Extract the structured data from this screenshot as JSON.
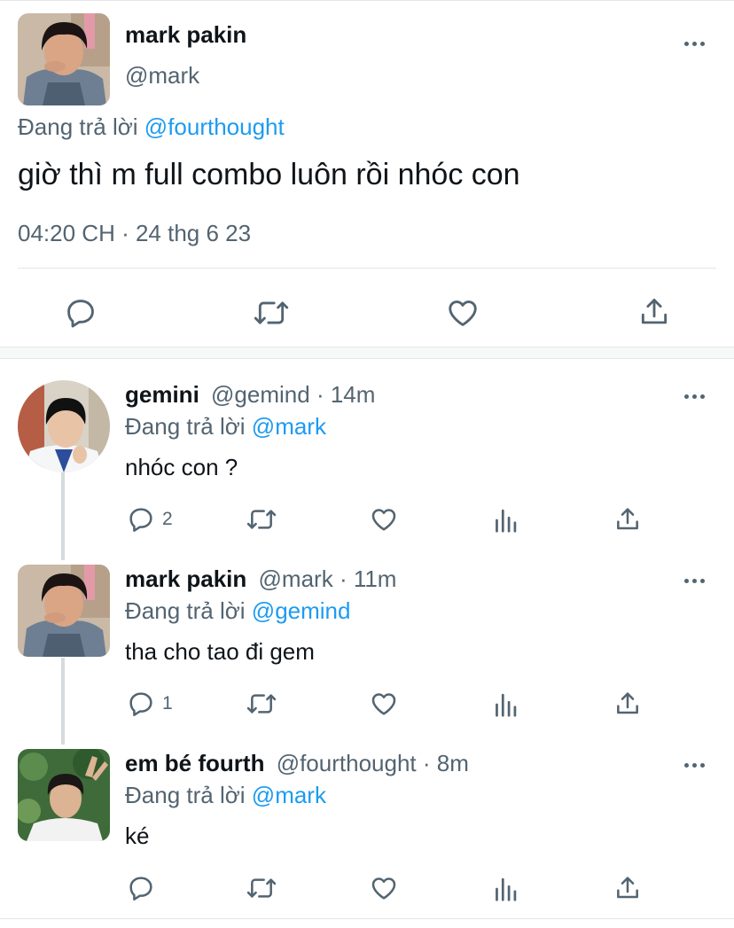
{
  "main_tweet": {
    "name": "mark pakin",
    "handle": "@mark",
    "replying_prefix": "Đang trả lời",
    "replying_to": "@fourthought",
    "text": "giờ thì m full combo luôn rồi nhóc con",
    "timestamp": "04:20 CH · 24 thg 6 23"
  },
  "replies": [
    {
      "name": "gemini",
      "handle": "@gemind",
      "time": "· 14m",
      "replying_prefix": "Đang trả lời",
      "replying_to": "@mark",
      "text": "nhóc con ?",
      "reply_count": "2"
    },
    {
      "name": "mark pakin",
      "handle": "@mark",
      "time": "· 11m",
      "replying_prefix": "Đang trả lời",
      "replying_to": "@gemind",
      "text": "tha cho tao đi gem",
      "reply_count": "1"
    },
    {
      "name": "em bé fourth",
      "handle": "@fourthought",
      "time": "· 8m",
      "replying_prefix": "Đang trả lời",
      "replying_to": "@mark",
      "text": "ké",
      "reply_count": ""
    }
  ],
  "colors": {
    "link": "#1d9bf0",
    "secondary_text": "#536471",
    "thread_line": "#d6dbdf"
  },
  "icons": [
    "reply-icon",
    "retweet-icon",
    "like-icon",
    "share-icon",
    "analytics-icon",
    "more-icon"
  ]
}
